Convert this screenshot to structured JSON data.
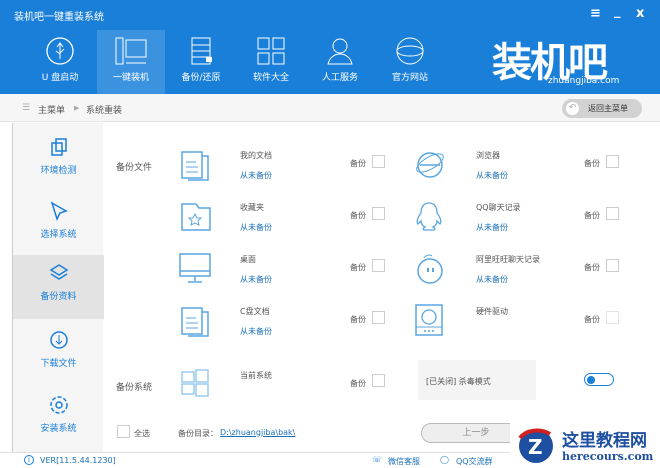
{
  "window": {
    "title": "装机吧一键重装系统",
    "menu": "≡",
    "minimize": "_",
    "close": "x"
  },
  "nav": [
    {
      "label": "U 盘启动"
    },
    {
      "label": "一键装机"
    },
    {
      "label": "备份/还原"
    },
    {
      "label": "软件大全"
    },
    {
      "label": "人工服务"
    },
    {
      "label": "官方网站"
    }
  ],
  "logo": {
    "text": "装机吧",
    "sub": "zhuangjiba.com"
  },
  "breadcrumb": {
    "root": "主菜单",
    "current": "系统重装",
    "back": "返回主菜单"
  },
  "sidebar": [
    {
      "label": "环境检测"
    },
    {
      "label": "选择系统"
    },
    {
      "label": "备份资料"
    },
    {
      "label": "下载文件"
    },
    {
      "label": "安装系统"
    }
  ],
  "main": {
    "backup_files_label": "备份文件",
    "backup_system_label": "备份系统",
    "backup_word": "备份",
    "left": [
      {
        "name": "我的文档",
        "status": "从未备份"
      },
      {
        "name": "收藏夹",
        "status": "从未备份"
      },
      {
        "name": "桌面",
        "status": "从未备份"
      },
      {
        "name": "C盘文档",
        "status": "从未备份"
      }
    ],
    "right": [
      {
        "name": "浏览器",
        "status": "从未备份"
      },
      {
        "name": "QQ聊天记录",
        "status": "从未备份"
      },
      {
        "name": "阿里旺旺聊天记录",
        "status": "从未备份"
      },
      {
        "name": "硬件驱动"
      }
    ],
    "system": {
      "name": "当前系统"
    },
    "antivirus": {
      "label": "[已关闭] 杀毒模式",
      "on": false
    },
    "select_all": "全选",
    "dir_label": "备份目录：",
    "dir_path": "D:\\zhuangjiba\\bak\\",
    "prev": "上一步"
  },
  "status": {
    "version": "VER[11.5.44.1230]",
    "wechat": "微信客服",
    "qq": "QQ交流群"
  },
  "watermark": {
    "title": "这里教程网",
    "url": "herecours.com"
  }
}
